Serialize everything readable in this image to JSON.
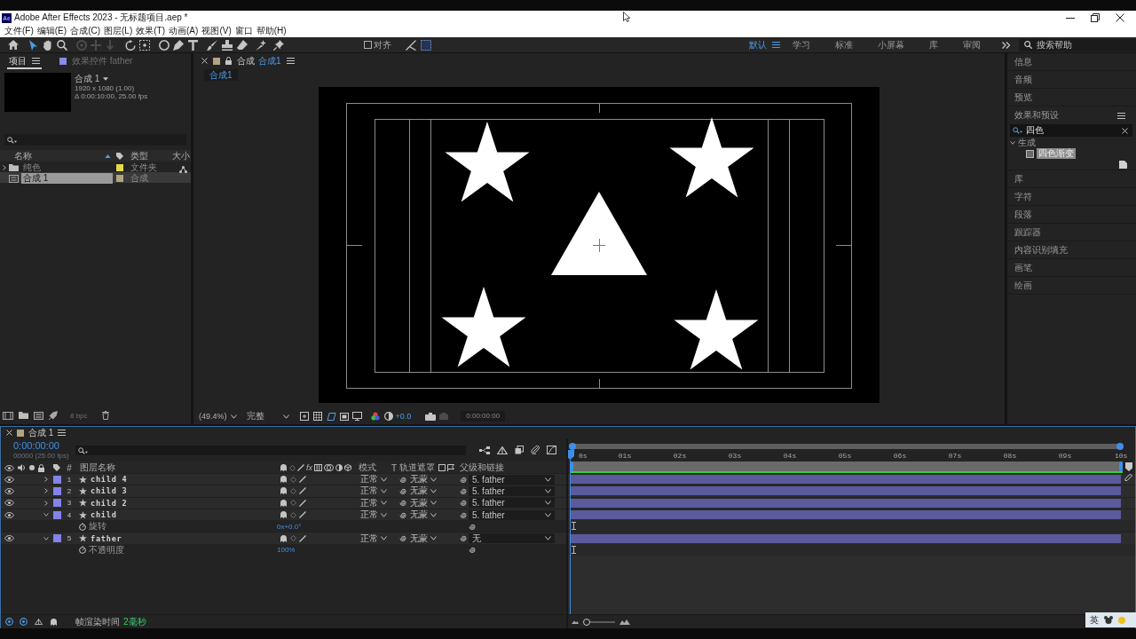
{
  "title_bar": {
    "app_icon": "Ae",
    "title": "Adobe After Effects 2023 - 无标题项目.aep *"
  },
  "menu": [
    "文件(F)",
    "编辑(E)",
    "合成(C)",
    "图层(L)",
    "效果(T)",
    "动画(A)",
    "视图(V)",
    "窗口",
    "帮助(H)"
  ],
  "toolbar": {
    "snap": {
      "label": "对齐",
      "checked": false
    }
  },
  "workspaces": {
    "items": [
      {
        "label": "默认",
        "selected": true
      },
      {
        "label": "学习",
        "selected": false
      },
      {
        "label": "标准",
        "selected": false
      },
      {
        "label": "小屏幕",
        "selected": false
      },
      {
        "label": "库",
        "selected": false
      },
      {
        "label": "审阅",
        "selected": false
      }
    ],
    "search_placeholder": "搜索帮助"
  },
  "project_panel": {
    "tabs": [
      {
        "label": "项目",
        "selected": true
      },
      {
        "label": "效果控件 father",
        "selected": false
      }
    ],
    "preview": {
      "name": "合成 1",
      "resolution": "1920 x 1080 (1.00)",
      "duration": "Δ 0:00:10:00, 25.00 fps"
    },
    "columns": [
      "名称",
      "类型",
      "大小"
    ],
    "items": [
      {
        "kind": "folder",
        "name": "纯色",
        "expanded": false,
        "color": "#e3d94c",
        "type": "文件夹",
        "selected": false
      },
      {
        "kind": "composition",
        "name": "合成 1",
        "color": "#b2a47f",
        "type": "合成",
        "selected": true
      }
    ],
    "bit_depth": "8 bpc"
  },
  "viewer": {
    "tab": {
      "label": "合成",
      "name": "合成1"
    },
    "breadcrumb": "合成1",
    "zoom": "(49.4%)",
    "resolution": "完整",
    "exposure": "+0.0",
    "timecode": "0:00:00:00"
  },
  "side_panels": {
    "top": [
      "信息",
      "音频",
      "预览"
    ],
    "effects": {
      "title": "效果和预设",
      "search": "四色",
      "tree": [
        {
          "label": "生成",
          "expanded": true,
          "selected": false,
          "children": [
            {
              "label": "四色渐变",
              "selected": true
            }
          ]
        }
      ]
    },
    "bottom": [
      "库",
      "字符",
      "段落",
      "跟踪器",
      "内容识别填充",
      "画笔",
      "绘画"
    ]
  },
  "timeline": {
    "tab": "合成 1",
    "timecode": "0:00:00:00",
    "frame_info": "00000 (25.00 fps)",
    "columns": {
      "number": "#",
      "layer_name": "图层名称",
      "fx": "fx",
      "mode": "模式",
      "t": "T",
      "track_matte": "轨道遮罩",
      "parent": "父级和链接"
    },
    "layers": [
      {
        "index": "1",
        "name": "child 4",
        "color": "#8383ea",
        "expanded": false,
        "mode": "正常",
        "track_matte": "无蒙",
        "parent": "5. father"
      },
      {
        "index": "2",
        "name": "child 3",
        "color": "#8383ea",
        "expanded": false,
        "mode": "正常",
        "track_matte": "无蒙",
        "parent": "5. father"
      },
      {
        "index": "3",
        "name": "child 2",
        "color": "#8383ea",
        "expanded": false,
        "mode": "正常",
        "track_matte": "无蒙",
        "parent": "5. father"
      },
      {
        "index": "4",
        "name": "child",
        "color": "#8383ea",
        "expanded": true,
        "mode": "正常",
        "track_matte": "无蒙",
        "parent": "5. father",
        "properties": [
          {
            "name": "旋转",
            "value": "0x+0.0°"
          }
        ]
      },
      {
        "index": "5",
        "name": "father",
        "color": "#8383ea",
        "expanded": true,
        "mode": "正常",
        "track_matte": "无蒙",
        "parent": "无",
        "properties": [
          {
            "name": "不透明度",
            "value": "100%"
          }
        ]
      }
    ],
    "ruler": [
      "0s",
      "01s",
      "02s",
      "03s",
      "04s",
      "05s",
      "06s",
      "07s",
      "08s",
      "09s",
      "10s"
    ],
    "zoom_slider": {
      "level": 0
    },
    "render_time": {
      "label": "帧渲染时间",
      "value": "2毫秒"
    }
  },
  "ime": {
    "mode": "英"
  }
}
